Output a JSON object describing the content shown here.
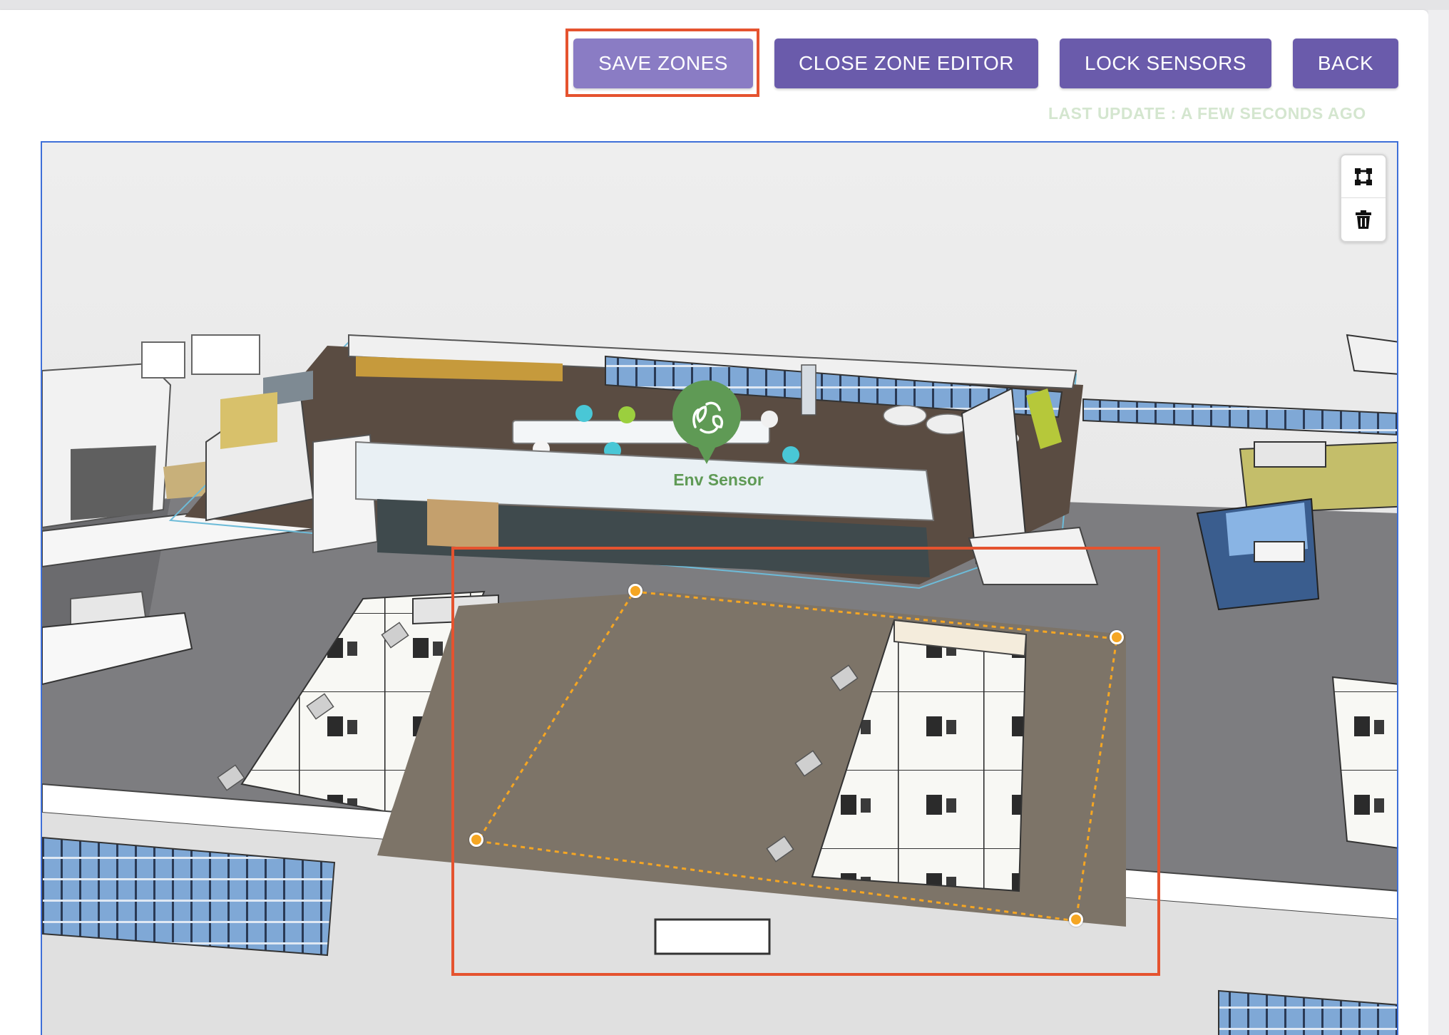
{
  "toolbar": {
    "save_label": "SAVE ZONES",
    "close_label": "CLOSE ZONE EDITOR",
    "lock_label": "LOCK SENSORS",
    "back_label": "BACK"
  },
  "status": {
    "last_update": "LAST UPDATE : A FEW SECONDS AGO"
  },
  "map_controls": {
    "draw_icon": "polygon-draw-icon",
    "delete_icon": "trash-icon"
  },
  "sensor": {
    "label": "Env Sensor",
    "icon": "leaves-recycle-icon",
    "color": "#5f9a55"
  },
  "colors": {
    "primary": "#6a5bab",
    "primary_active": "#8a7cc4",
    "highlight": "#e5532f",
    "zone_stroke": "#f5a623",
    "selection_outline": "#3e6fd8",
    "status_text": "#d4e6cf"
  }
}
